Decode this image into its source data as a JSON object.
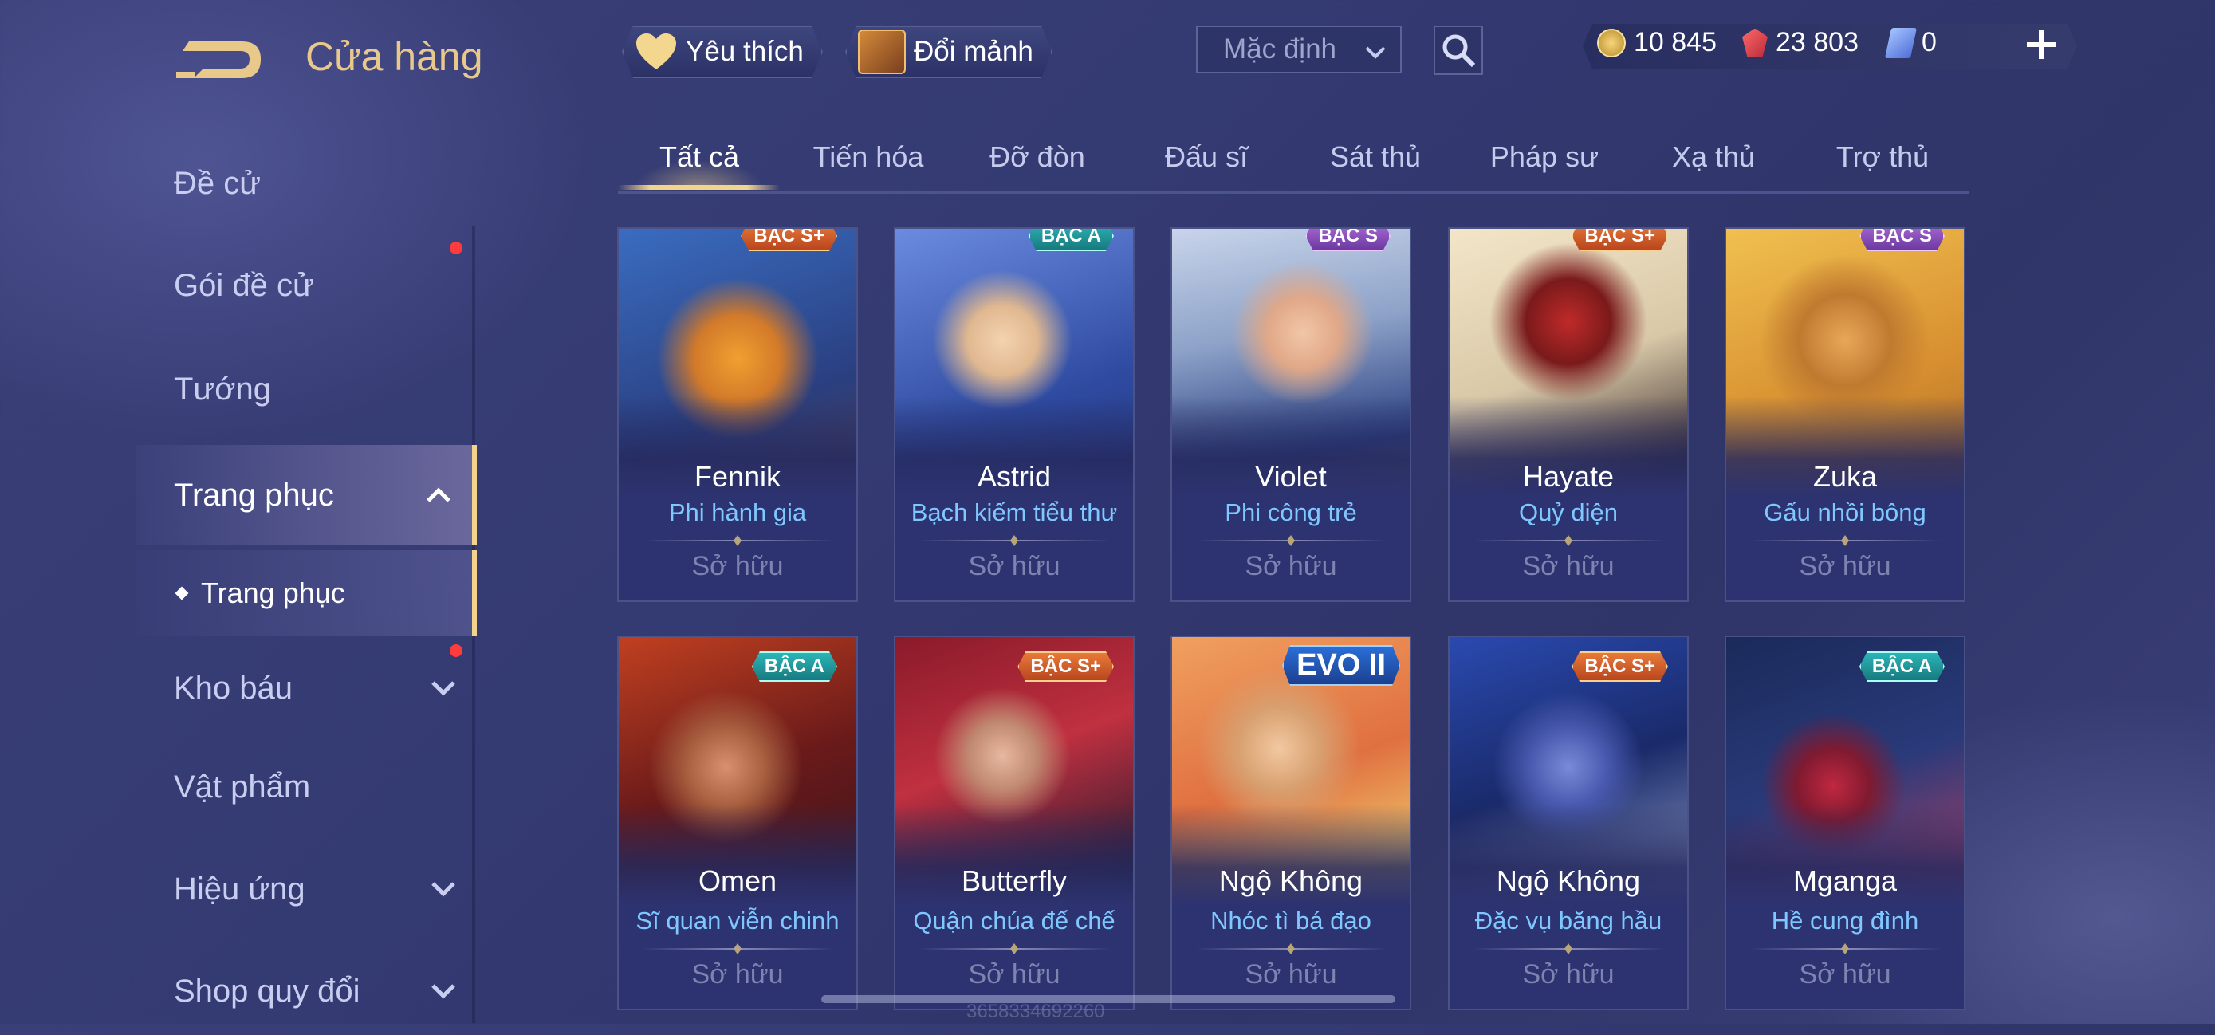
{
  "header": {
    "title": "Cửa hàng",
    "favorites_label": "Yêu thích",
    "exchange_label": "Đổi mảnh",
    "sort": {
      "value": "Mặc định"
    },
    "currencies": {
      "gold": "10 845",
      "ruby": "23 803",
      "voucher": "0"
    }
  },
  "sidebar": {
    "items": [
      {
        "label": "Đề cử"
      },
      {
        "label": "Gói đề cử"
      },
      {
        "label": "Tướng"
      },
      {
        "label": "Trang phục"
      },
      {
        "label": "Kho báu"
      },
      {
        "label": "Vật phẩm"
      },
      {
        "label": "Hiệu ứng"
      },
      {
        "label": "Shop quy đổi"
      }
    ],
    "sub_item": "Trang phục"
  },
  "tabs": [
    "Tất cả",
    "Tiến hóa",
    "Đỡ đòn",
    "Đấu sĩ",
    "Sát thủ",
    "Pháp sư",
    "Xạ thủ",
    "Trợ thủ"
  ],
  "cards": [
    {
      "tier": "BẬC S+",
      "hero": "Fennik",
      "skin": "Phi hành gia",
      "status": "Sở hữu"
    },
    {
      "tier": "BẬC A",
      "hero": "Astrid",
      "skin": "Bạch kiếm tiểu thư",
      "status": "Sở hữu"
    },
    {
      "tier": "BẬC S",
      "hero": "Violet",
      "skin": "Phi công trẻ",
      "status": "Sở hữu"
    },
    {
      "tier": "BẬC S+",
      "hero": "Hayate",
      "skin": "Quỷ diện",
      "status": "Sở hữu"
    },
    {
      "tier": "BẬC S",
      "hero": "Zuka",
      "skin": "Gấu nhồi bông",
      "status": "Sở hữu"
    },
    {
      "tier": "BẬC A",
      "hero": "Omen",
      "skin": "Sĩ quan viễn chinh",
      "status": "Sở hữu"
    },
    {
      "tier": "BẬC S+",
      "hero": "Butterfly",
      "skin": "Quận chúa đế chế",
      "status": "Sở hữu"
    },
    {
      "tier": "EVO II",
      "hero": "Ngộ Không",
      "skin": "Nhóc tì bá đạo",
      "status": "Sở hữu"
    },
    {
      "tier": "BẬC S+",
      "hero": "Ngộ Không",
      "skin": "Đặc vụ băng hầu",
      "status": "Sở hữu"
    },
    {
      "tier": "BẬC A",
      "hero": "Mganga",
      "skin": "Hề cung đình",
      "status": "Sở hữu"
    }
  ],
  "footer": {
    "uid": "3658334692260"
  },
  "colors": {
    "accent": "#f2d48a",
    "skin_name": "#7fc8ff",
    "owned": "#7e84b0",
    "badge_dot": "#ff3b3b"
  }
}
